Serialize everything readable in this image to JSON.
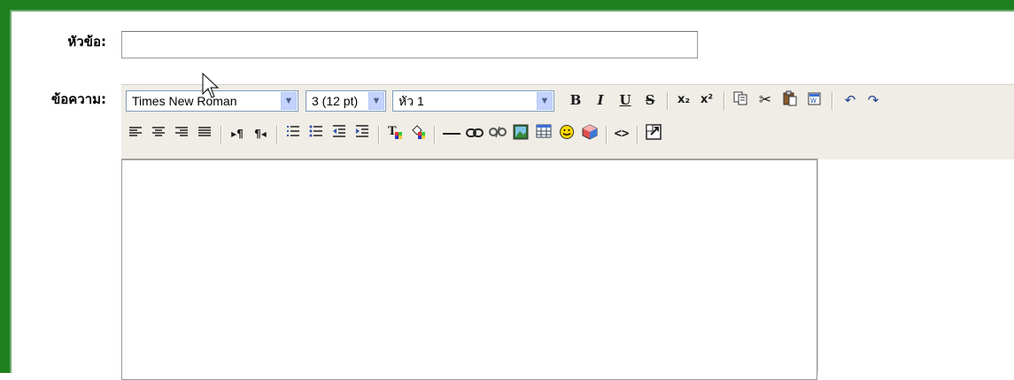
{
  "form": {
    "subject_label": "หัวข้อ:",
    "subject_value": "",
    "message_label": "ข้อความ:"
  },
  "toolbar": {
    "font_value": "Times New Roman",
    "size_value": "3 (12 pt)",
    "format_value": "หัว 1",
    "bold_label": "B",
    "italic_label": "I",
    "underline_label": "U",
    "strike_label": "S",
    "subscript_label": "x₂",
    "superscript_label": "x²",
    "ltr_label": "▸¶",
    "rtl_label": "¶◂",
    "html_source_label": "<>"
  },
  "icons": {
    "dropdown": "chevron-down-icon",
    "copy": "copy-icon",
    "cut": "scissors-icon",
    "paste": "paste-icon",
    "paste_word": "paste-from-word-icon",
    "undo": "undo-icon",
    "redo": "redo-icon",
    "align_left": "align-left-icon",
    "align_center": "align-center-icon",
    "align_right": "align-right-icon",
    "align_justify": "align-justify-icon",
    "ordered_list": "ordered-list-icon",
    "unordered_list": "unordered-list-icon",
    "outdent": "outdent-icon",
    "indent": "indent-icon",
    "text_color": "text-color-icon",
    "bg_color": "background-color-icon",
    "hr": "horizontal-rule-icon",
    "link": "link-icon",
    "unlink": "unlink-icon",
    "image": "image-icon",
    "table": "table-icon",
    "smiley": "smiley-icon",
    "special_char": "special-char-icon",
    "fullscreen": "fullscreen-icon"
  },
  "colors": {
    "frame": "#1e7f1e",
    "toolbar_bg": "#efede6",
    "dropdown_accent": "#c3d3fd"
  }
}
